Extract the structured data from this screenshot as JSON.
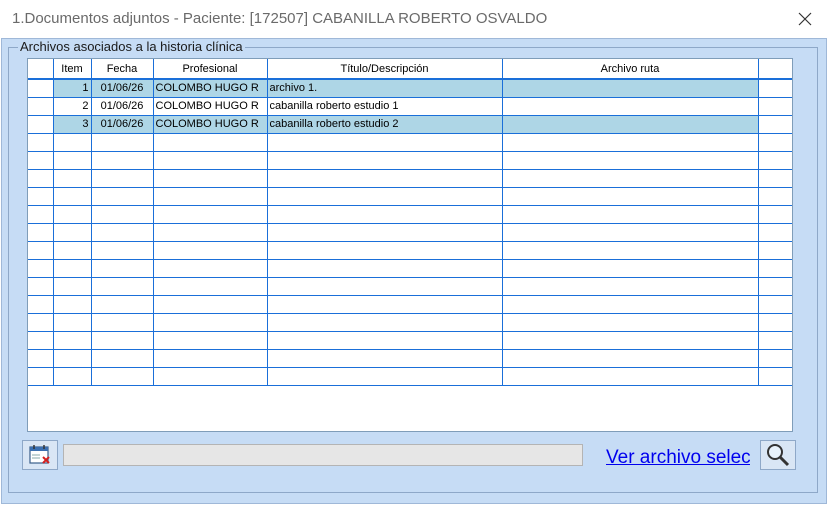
{
  "window": {
    "title": "1.Documentos adjuntos - Paciente: [172507] CABANILLA ROBERTO OSVALDO",
    "close_icon": "close-icon"
  },
  "group": {
    "label": "Archivos asociados a la historia clínica"
  },
  "table": {
    "columns": [
      "",
      "Item",
      "Fecha",
      "Profesional",
      "Título/Descripción",
      "Archivo ruta",
      ""
    ],
    "rows": [
      {
        "item": "1",
        "fecha": "01/06/26",
        "profesional": "COLOMBO HUGO R",
        "titulo": "archivo 1.",
        "ruta": ""
      },
      {
        "item": "2",
        "fecha": "01/06/26",
        "profesional": "COLOMBO HUGO R",
        "titulo": "cabanilla roberto estudio 1",
        "ruta": ""
      },
      {
        "item": "3",
        "fecha": "01/06/26",
        "profesional": "COLOMBO HUGO R",
        "titulo": "cabanilla roberto estudio 2",
        "ruta": ""
      }
    ],
    "highlight_color": "#aed6e6",
    "grid_color": "#1a6fd9"
  },
  "footer": {
    "calendar_icon": "calendar-delete-icon",
    "path_value": "",
    "view_link": "Ver archivo seleccionado",
    "search_icon": "magnifier-icon"
  }
}
